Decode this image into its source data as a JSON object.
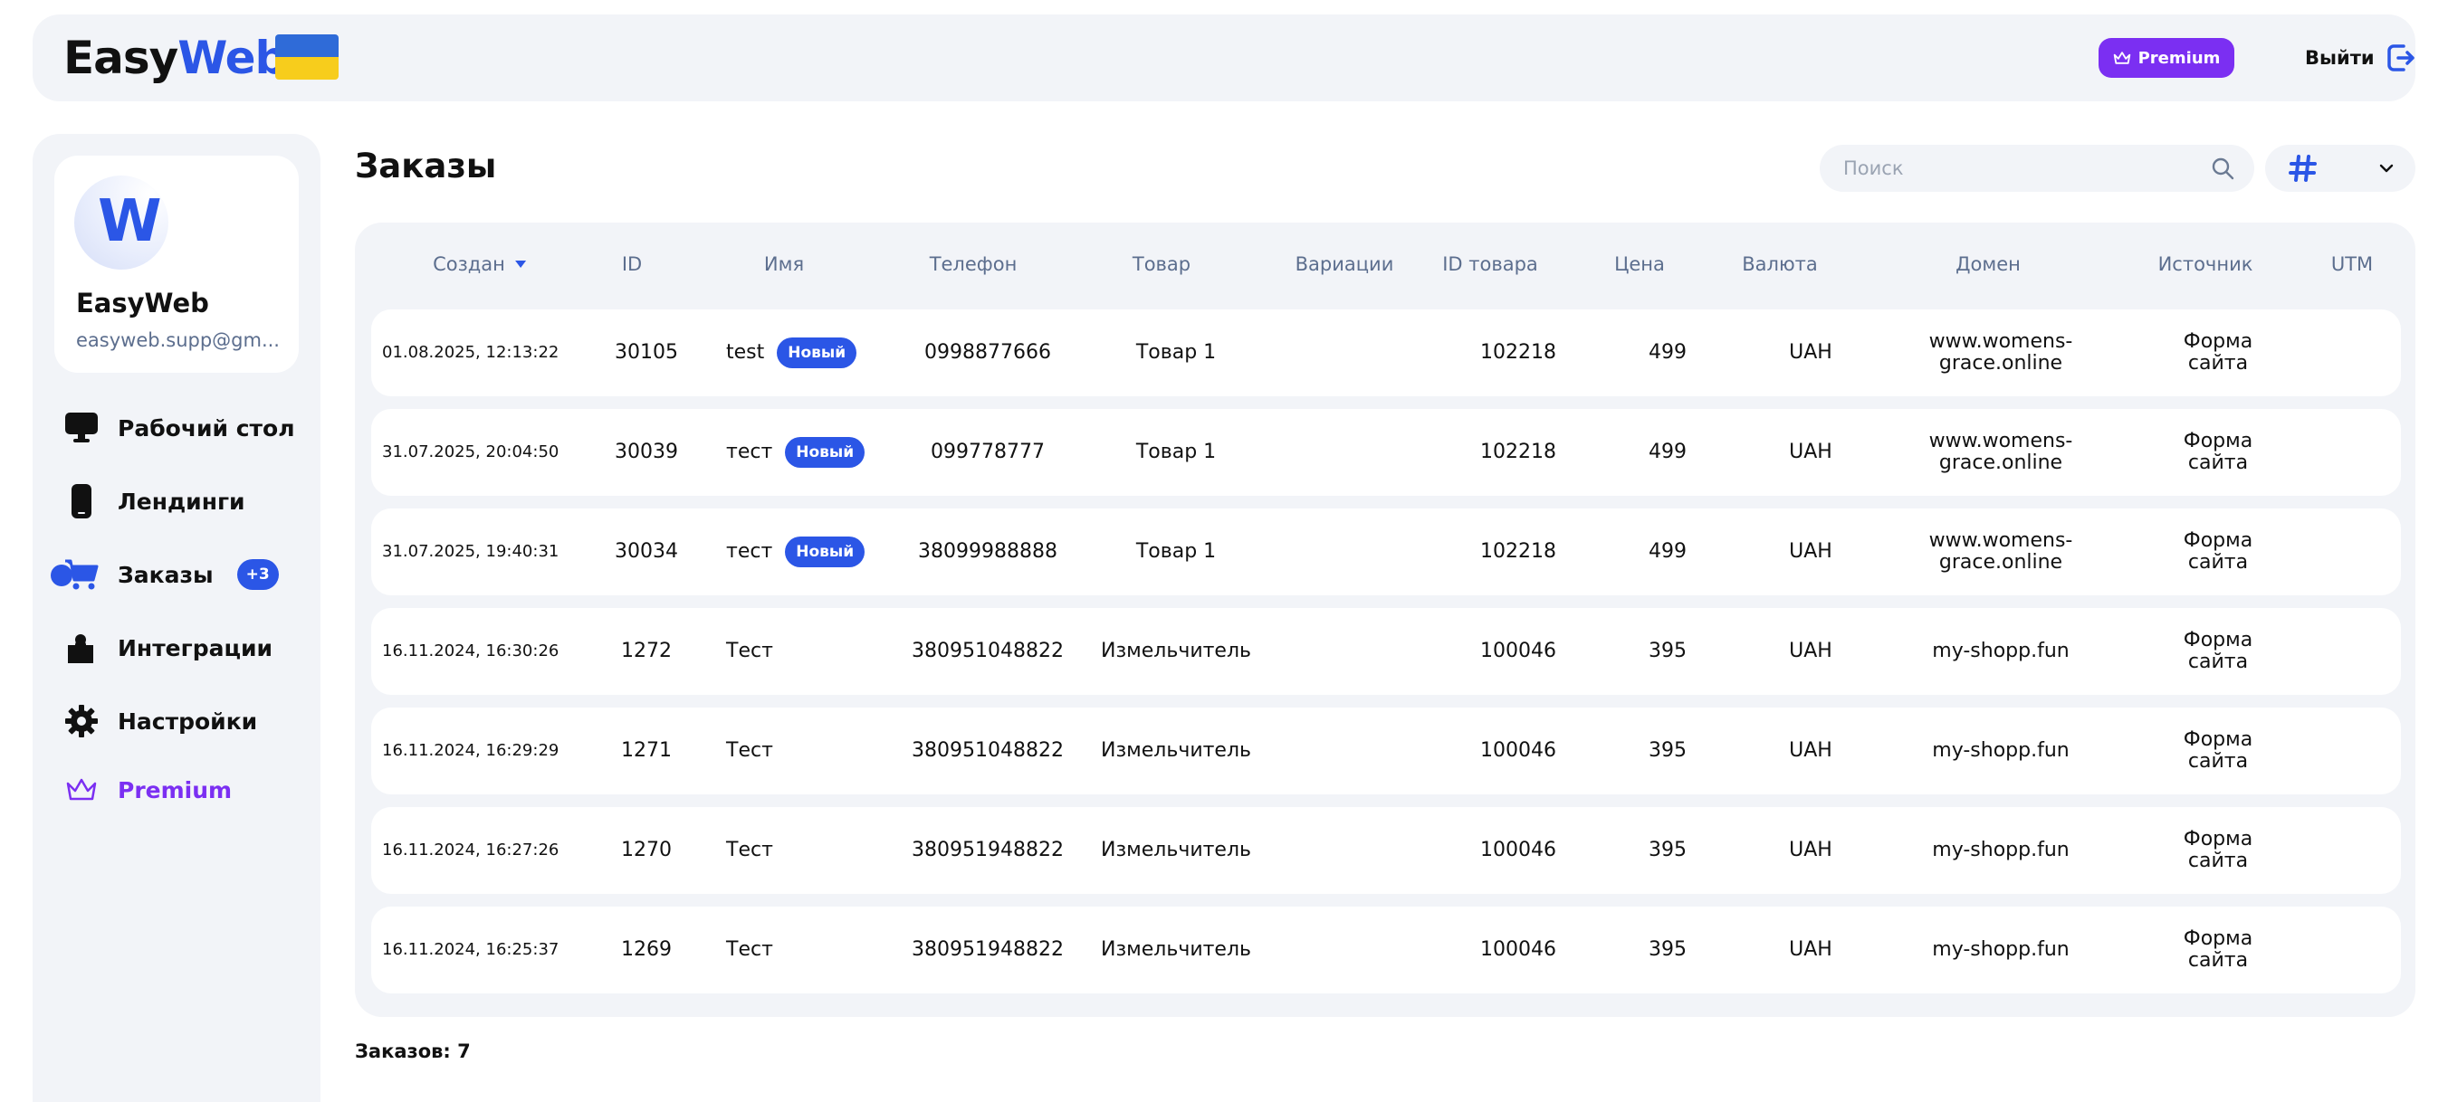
{
  "header": {
    "logo_part1": "Easy",
    "logo_part2": "Web",
    "premium_label": "Premium",
    "logout_label": "Выйти"
  },
  "colors": {
    "accent": "#2b56e6",
    "premium": "#7b2ff2",
    "panel": "#f2f4f8",
    "muted_text": "#5c6e8e"
  },
  "profile": {
    "avatar_letter": "W",
    "name": "EasyWeb",
    "email": "easyweb.supp@gm..."
  },
  "sidebar": {
    "items": [
      {
        "label": "Рабочий стол",
        "icon": "monitor-icon"
      },
      {
        "label": "Лендинги",
        "icon": "phone-icon"
      },
      {
        "label": "Заказы",
        "icon": "cart-icon",
        "badge": "+3",
        "active": true
      },
      {
        "label": "Интеграции",
        "icon": "puzzle-icon"
      },
      {
        "label": "Настройки",
        "icon": "gear-icon"
      },
      {
        "label": "Premium",
        "icon": "crown-icon"
      }
    ]
  },
  "main": {
    "title": "Заказы",
    "search_placeholder": "Поиск",
    "total_label": "Заказов: 7"
  },
  "table": {
    "columns": [
      "Создан",
      "ID",
      "Имя",
      "Телефон",
      "Товар",
      "Вариации",
      "ID товара",
      "Цена",
      "Валюта",
      "Домен",
      "Источник",
      "UTM"
    ],
    "sort_column": "Создан",
    "rows": [
      {
        "created": "01.08.2025, 12:13:22",
        "id": "30105",
        "name": "test",
        "status": "Новый",
        "phone": "0998877666",
        "product": "Товар 1",
        "variations": "",
        "product_id": "102218",
        "price": "499",
        "currency": "UAH",
        "domain_line1": "www.womens-",
        "domain_line2": "grace.online",
        "source_line1": "Форма",
        "source_line2": "сайта",
        "utm": ""
      },
      {
        "created": "31.07.2025, 20:04:50",
        "id": "30039",
        "name": "тест",
        "status": "Новый",
        "phone": "099778777",
        "product": "Товар 1",
        "variations": "",
        "product_id": "102218",
        "price": "499",
        "currency": "UAH",
        "domain_line1": "www.womens-",
        "domain_line2": "grace.online",
        "source_line1": "Форма",
        "source_line2": "сайта",
        "utm": ""
      },
      {
        "created": "31.07.2025, 19:40:31",
        "id": "30034",
        "name": "тест",
        "status": "Новый",
        "phone": "38099988888",
        "product": "Товар 1",
        "variations": "",
        "product_id": "102218",
        "price": "499",
        "currency": "UAH",
        "domain_line1": "www.womens-",
        "domain_line2": "grace.online",
        "source_line1": "Форма",
        "source_line2": "сайта",
        "utm": ""
      },
      {
        "created": "16.11.2024, 16:30:26",
        "id": "1272",
        "name": "Тест",
        "status": "",
        "phone": "380951048822",
        "product": "Измельчитель",
        "variations": "",
        "product_id": "100046",
        "price": "395",
        "currency": "UAH",
        "domain_line1": "my-shopp.fun",
        "domain_line2": "",
        "source_line1": "Форма",
        "source_line2": "сайта",
        "utm": ""
      },
      {
        "created": "16.11.2024, 16:29:29",
        "id": "1271",
        "name": "Тест",
        "status": "",
        "phone": "380951048822",
        "product": "Измельчитель",
        "variations": "",
        "product_id": "100046",
        "price": "395",
        "currency": "UAH",
        "domain_line1": "my-shopp.fun",
        "domain_line2": "",
        "source_line1": "Форма",
        "source_line2": "сайта",
        "utm": ""
      },
      {
        "created": "16.11.2024, 16:27:26",
        "id": "1270",
        "name": "Тест",
        "status": "",
        "phone": "380951948822",
        "product": "Измельчитель",
        "variations": "",
        "product_id": "100046",
        "price": "395",
        "currency": "UAH",
        "domain_line1": "my-shopp.fun",
        "domain_line2": "",
        "source_line1": "Форма",
        "source_line2": "сайта",
        "utm": ""
      },
      {
        "created": "16.11.2024, 16:25:37",
        "id": "1269",
        "name": "Тест",
        "status": "",
        "phone": "380951948822",
        "product": "Измельчитель",
        "variations": "",
        "product_id": "100046",
        "price": "395",
        "currency": "UAH",
        "domain_line1": "my-shopp.fun",
        "domain_line2": "",
        "source_line1": "Форма",
        "source_line2": "сайта",
        "utm": ""
      }
    ]
  }
}
